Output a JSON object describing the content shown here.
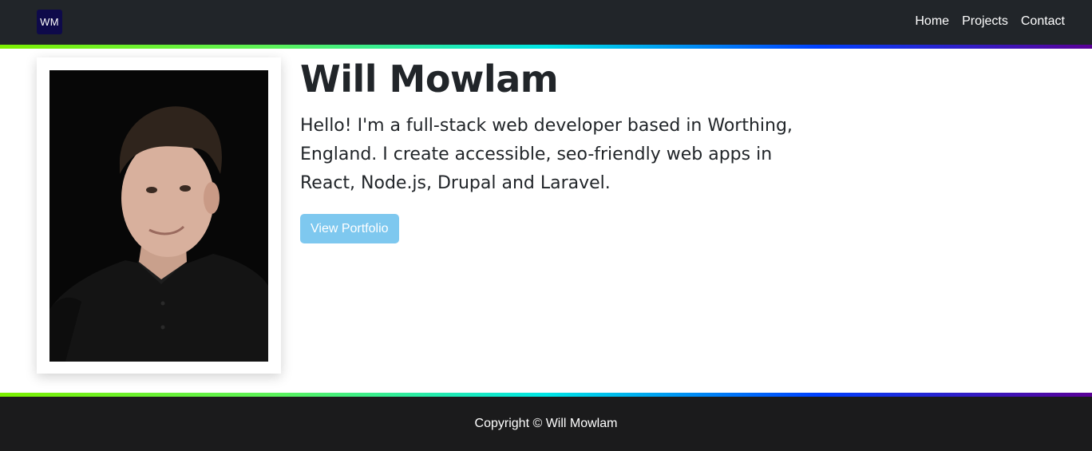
{
  "nav": {
    "brand": "WM",
    "links": [
      {
        "label": "Home"
      },
      {
        "label": "Projects"
      },
      {
        "label": "Contact"
      }
    ]
  },
  "hero": {
    "name": "Will Mowlam",
    "bio": "Hello! I'm a full-stack web developer based in Worthing, England. I create accessible, seo-friendly web apps in React, Node.js, Drupal and Laravel.",
    "button": "View Portfolio"
  },
  "footer": {
    "copyright": "Copyright © Will Mowlam"
  },
  "colors": {
    "navbar": "#212529",
    "brand_bg": "#0e0a4a",
    "button": "#7ec8ef",
    "footer": "#1b1b1c",
    "gradient": [
      "#7cf000",
      "#00e6e6",
      "#0040ff",
      "#5a0096"
    ]
  }
}
